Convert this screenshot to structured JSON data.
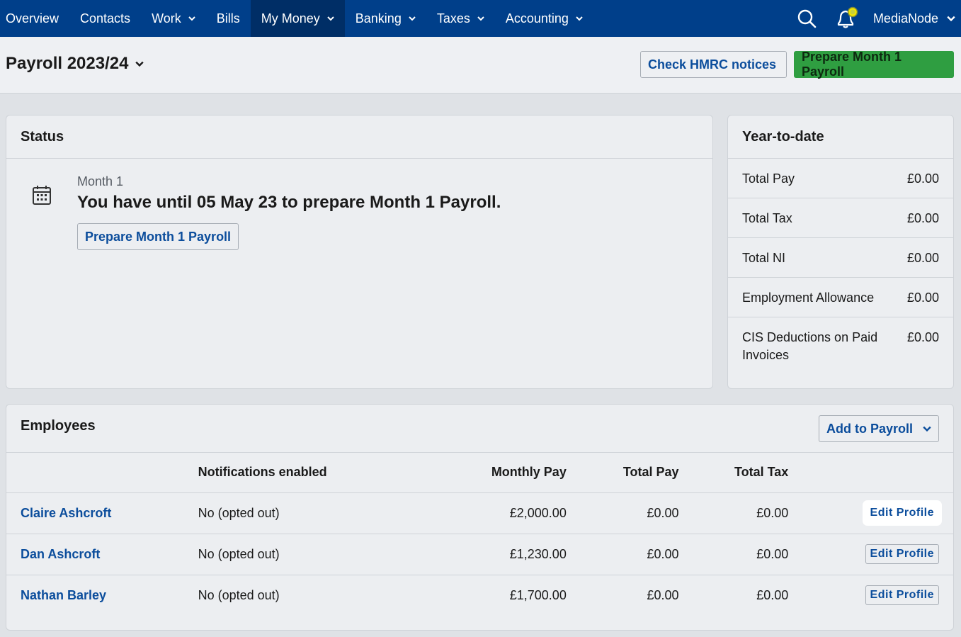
{
  "nav": {
    "items": [
      {
        "label": "Overview"
      },
      {
        "label": "Contacts"
      },
      {
        "label": "Work"
      },
      {
        "label": "Bills"
      },
      {
        "label": "My Money"
      },
      {
        "label": "Banking"
      },
      {
        "label": "Taxes"
      },
      {
        "label": "Accounting"
      }
    ],
    "org_name": "MediaNode"
  },
  "header": {
    "title": "Payroll 2023/24",
    "check_hmrc_label": "Check HMRC notices",
    "prepare_label": "Prepare Month 1 Payroll"
  },
  "status": {
    "title": "Status",
    "month": "Month 1",
    "message": "You have until 05 May 23 to prepare Month 1 Payroll.",
    "button_label": "Prepare Month 1 Payroll"
  },
  "ytd": {
    "title": "Year-to-date",
    "rows": [
      {
        "label": "Total Pay",
        "value": "£0.00"
      },
      {
        "label": "Total Tax",
        "value": "£0.00"
      },
      {
        "label": "Total NI",
        "value": "£0.00"
      },
      {
        "label": "Employment Allowance",
        "value": "£0.00"
      },
      {
        "label": "CIS Deductions on Paid Invoices",
        "value": "£0.00"
      }
    ]
  },
  "employees": {
    "title": "Employees",
    "add_label": "Add to Payroll",
    "columns": [
      "Notifications enabled",
      "Monthly Pay",
      "Total Pay",
      "Total Tax"
    ],
    "rows": [
      {
        "name": "Claire Ashcroft",
        "notifications": "No (opted out)",
        "monthly_pay": "£2,000.00",
        "total_pay": "£0.00",
        "total_tax": "£0.00",
        "action": "Edit Profile"
      },
      {
        "name": "Dan Ashcroft",
        "notifications": "No (opted out)",
        "monthly_pay": "£1,230.00",
        "total_pay": "£0.00",
        "total_tax": "£0.00",
        "action": "Edit Profile"
      },
      {
        "name": "Nathan Barley",
        "notifications": "No (opted out)",
        "monthly_pay": "£1,700.00",
        "total_pay": "£0.00",
        "total_tax": "£0.00",
        "action": "Edit Profile"
      }
    ]
  },
  "icons": {
    "search": "search-icon",
    "notifications": "bell-icon",
    "calendar": "calendar-icon",
    "chevron": "chevron-down-icon"
  },
  "colors": {
    "nav_bg": "#003f8a",
    "nav_active": "#002e66",
    "link": "#0b4d9c",
    "primary_button": "#2f9e41",
    "notification_dot": "#f2e500"
  }
}
